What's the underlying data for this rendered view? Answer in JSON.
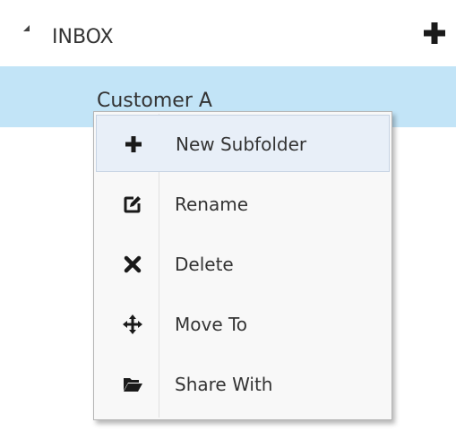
{
  "folder_tree": {
    "root": {
      "label": "INBOX",
      "expand_icon": "expanded-triangle-icon",
      "add_icon": "plus-icon"
    },
    "selected_child": {
      "label": "Customer A"
    }
  },
  "context_menu": {
    "items": [
      {
        "label": "New Subfolder",
        "icon": "plus-icon",
        "highlighted": true
      },
      {
        "label": "Rename",
        "icon": "edit-icon",
        "highlighted": false
      },
      {
        "label": "Delete",
        "icon": "close-x-icon",
        "highlighted": false
      },
      {
        "label": "Move To",
        "icon": "move-arrows-icon",
        "highlighted": false
      },
      {
        "label": "Share With",
        "icon": "folder-open-icon",
        "highlighted": false
      }
    ]
  },
  "colors": {
    "selection_background": "#c2e4f7",
    "menu_background": "#f8f8f8",
    "menu_highlight": "#e8eff8",
    "text": "#333333",
    "icon": "#1a1a1a"
  }
}
